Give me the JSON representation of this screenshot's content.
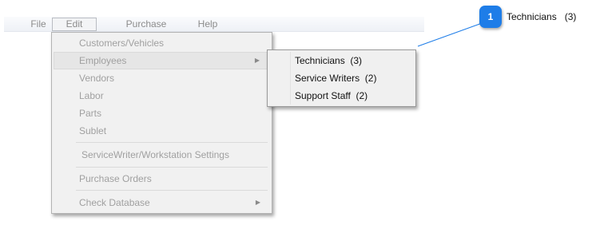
{
  "menubar": {
    "file": "File",
    "edit": "Edit",
    "purchase": "Purchase",
    "help": "Help"
  },
  "edit_menu": {
    "items": [
      "Customers/Vehicles",
      "Employees",
      "Vendors",
      "Labor",
      "Parts",
      "Sublet",
      "ServiceWriter/Workstation Settings",
      "Purchase Orders",
      "Check Database"
    ],
    "highlighted": "Employees"
  },
  "employees_submenu": {
    "items": [
      "Technicians  (3)",
      "Service Writers  (2)",
      "Support Staff  (2)"
    ]
  },
  "callout": {
    "number": "1",
    "text": "Technicians   (3)",
    "color": "#1e7de8"
  }
}
